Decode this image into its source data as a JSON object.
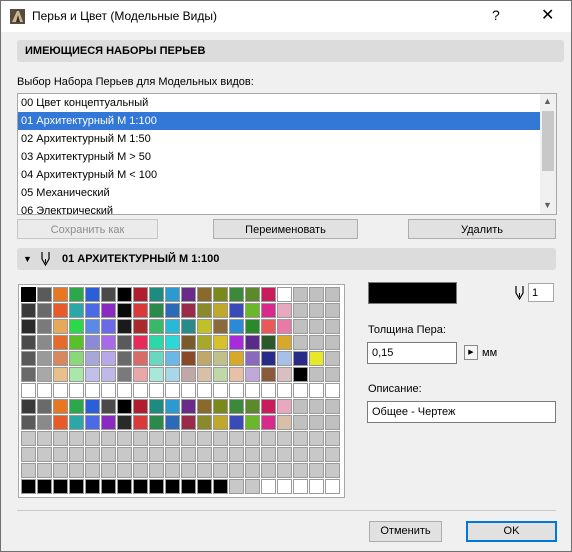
{
  "window": {
    "title": "Перья и Цвет (Модельные Виды)",
    "help_label": "?",
    "close_label": "✕"
  },
  "pen_sets": {
    "header": "ИМЕЮЩИЕСЯ НАБОРЫ ПЕРЬЕВ",
    "list_label": "Выбор Набора Перьев для Модельных видов:",
    "items": [
      "00 Цвет концептуальный",
      "01 Архитектурный М 1:100",
      "02 Архитектурный М 1:50",
      "03 Архитектурный М > 50",
      "04 Архитектурный М < 100",
      "05 Механический",
      "06 Электрический"
    ],
    "selected_index": 1,
    "save_as_label": "Сохранить как",
    "rename_label": "Переименовать",
    "delete_label": "Удалить"
  },
  "pen_panel": {
    "header": "01 АРХИТЕКТУРНЫЙ М 1:100",
    "selected_pen_number": "1",
    "selected_pen_color": "#000000",
    "thickness_label": "Толщина Пера:",
    "thickness_value": "0,15",
    "thickness_unit": "мм",
    "description_label": "Описание:",
    "description_value": "Общее - Чертеж"
  },
  "palette_rows": [
    [
      "#000000",
      "#5a5a5a",
      "#e87722",
      "#2aa84a",
      "#2b5fd9",
      "#4a4a4a",
      "#000000",
      "#b01d2e",
      "#1d8c7e",
      "#2a9ad0",
      "#6a2a8a",
      "#8a6a2a",
      "#7a8a1a",
      "#3a8a3a",
      "#5a8a2a",
      "#c81d5a",
      "#ffffff",
      "#c0c0c0",
      "#c0c0c0",
      "#c0c0c0"
    ],
    [
      "#3a3a3a",
      "#6a6a6a",
      "#e85a2a",
      "#2aa8a8",
      "#4a6ae8",
      "#8a2ac0",
      "#0a0a0a",
      "#d83a3a",
      "#2a8a4a",
      "#2a6ab8",
      "#9a2a4a",
      "#8a8a2a",
      "#c0a82a",
      "#3a4ab8",
      "#6ab82a",
      "#d82a8a",
      "#e8a8c0",
      "#c0c0c0",
      "#c0c0c0",
      "#c0c0c0"
    ],
    [
      "#2a2a2a",
      "#7a7a7a",
      "#e8a85a",
      "#2ad84a",
      "#5a8ae8",
      "#6a6ae8",
      "#1a1a1a",
      "#a82a2a",
      "#3ab86a",
      "#2ab8d8",
      "#2a8a8a",
      "#c0c02a",
      "#8a6a3a",
      "#2a8ad8",
      "#2a8a2a",
      "#e85a5a",
      "#e87aa8",
      "#c0c0c0",
      "#c0c0c0",
      "#c0c0c0"
    ],
    [
      "#4a4a4a",
      "#8a8a8a",
      "#e86a2a",
      "#5ac02a",
      "#8a8ad8",
      "#a86ae8",
      "#5a5a5a",
      "#e82a5a",
      "#2ad8a8",
      "#2ad8d8",
      "#7a5a2a",
      "#a8a82a",
      "#d8c02a",
      "#a82ad8",
      "#5a2a8a",
      "#2a5a2a",
      "#d8a82a",
      "#c0c0c0",
      "#c0c0c0",
      "#c0c0c0"
    ],
    [
      "#5a5a5a",
      "#9a9a9a",
      "#d8885a",
      "#8ad87a",
      "#a8a8d8",
      "#b8a8e8",
      "#6a6a6a",
      "#d86a6a",
      "#6ad8c0",
      "#6ab8e8",
      "#8a4a2a",
      "#c0a86a",
      "#c0c08a",
      "#d8a82a",
      "#8a6ac0",
      "#2a2a8a",
      "#a8c0e8",
      "#2a2a8a",
      "#e8e82a",
      "#c0c0c0"
    ],
    [
      "#6a6a6a",
      "#a8a8a8",
      "#e8c08a",
      "#a8e8a8",
      "#c0c0e8",
      "#c0b8e8",
      "#7a7a7a",
      "#e8a8a8",
      "#a8e8d8",
      "#a8d8e8",
      "#c0a8a8",
      "#d8c0a8",
      "#c0d8a8",
      "#e8c0a8",
      "#c0a8d8",
      "#8a5a3a",
      "#d8c0c0",
      "#000000",
      "#c0c0c0",
      "#c0c0c0"
    ],
    [
      "#ffffff",
      "#ffffff",
      "#ffffff",
      "#ffffff",
      "#ffffff",
      "#ffffff",
      "#ffffff",
      "#ffffff",
      "#ffffff",
      "#ffffff",
      "#ffffff",
      "#ffffff",
      "#ffffff",
      "#ffffff",
      "#ffffff",
      "#ffffff",
      "#ffffff",
      "#ffffff",
      "#ffffff",
      "#ffffff"
    ],
    [
      "#3a3a3a",
      "#6a6a6a",
      "#e87722",
      "#2aa84a",
      "#2b5fd9",
      "#4a4a4a",
      "#000000",
      "#b01d2e",
      "#1d8c7e",
      "#2a9ad0",
      "#6a2a8a",
      "#8a6a2a",
      "#7a8a1a",
      "#3a8a3a",
      "#5a8a2a",
      "#c81d5a",
      "#e8a8c0",
      "#c0c0c0",
      "#c0c0c0",
      "#c0c0c0"
    ],
    [
      "#5a5a5a",
      "#8a8a8a",
      "#e85a2a",
      "#2aa8a8",
      "#4a6ae8",
      "#8a2ac0",
      "#2a2a2a",
      "#d83a3a",
      "#2a8a4a",
      "#2a6ab8",
      "#9a2a4a",
      "#8a8a2a",
      "#c0a82a",
      "#3a4ab8",
      "#6ab82a",
      "#d82a8a",
      "#d8c0a8",
      "#c0c0c0",
      "#c0c0c0",
      "#c0c0c0"
    ],
    [
      "#c8c8c8",
      "#c8c8c8",
      "#c8c8c8",
      "#c8c8c8",
      "#c8c8c8",
      "#c8c8c8",
      "#c8c8c8",
      "#c8c8c8",
      "#c8c8c8",
      "#c8c8c8",
      "#c8c8c8",
      "#c8c8c8",
      "#c8c8c8",
      "#c8c8c8",
      "#c8c8c8",
      "#c8c8c8",
      "#c8c8c8",
      "#c8c8c8",
      "#c8c8c8",
      "#c8c8c8"
    ],
    [
      "#c8c8c8",
      "#c8c8c8",
      "#c8c8c8",
      "#c8c8c8",
      "#c8c8c8",
      "#c8c8c8",
      "#c8c8c8",
      "#c8c8c8",
      "#c8c8c8",
      "#c8c8c8",
      "#c8c8c8",
      "#c8c8c8",
      "#c8c8c8",
      "#c8c8c8",
      "#c8c8c8",
      "#c8c8c8",
      "#c8c8c8",
      "#c8c8c8",
      "#c8c8c8",
      "#c8c8c8"
    ],
    [
      "#c8c8c8",
      "#c8c8c8",
      "#c8c8c8",
      "#c8c8c8",
      "#c8c8c8",
      "#c8c8c8",
      "#c8c8c8",
      "#c8c8c8",
      "#c8c8c8",
      "#c8c8c8",
      "#c8c8c8",
      "#c8c8c8",
      "#c8c8c8",
      "#c8c8c8",
      "#c8c8c8",
      "#c8c8c8",
      "#c8c8c8",
      "#c8c8c8",
      "#c8c8c8",
      "#c8c8c8"
    ],
    [
      "#000000",
      "#000000",
      "#000000",
      "#000000",
      "#000000",
      "#000000",
      "#000000",
      "#000000",
      "#000000",
      "#000000",
      "#000000",
      "#000000",
      "#000000",
      "#c8c8c8",
      "#c8c8c8",
      "#ffffff",
      "#ffffff",
      "#ffffff",
      "#ffffff",
      "#ffffff"
    ]
  ],
  "footer": {
    "cancel_label": "Отменить",
    "ok_label": "OK"
  }
}
